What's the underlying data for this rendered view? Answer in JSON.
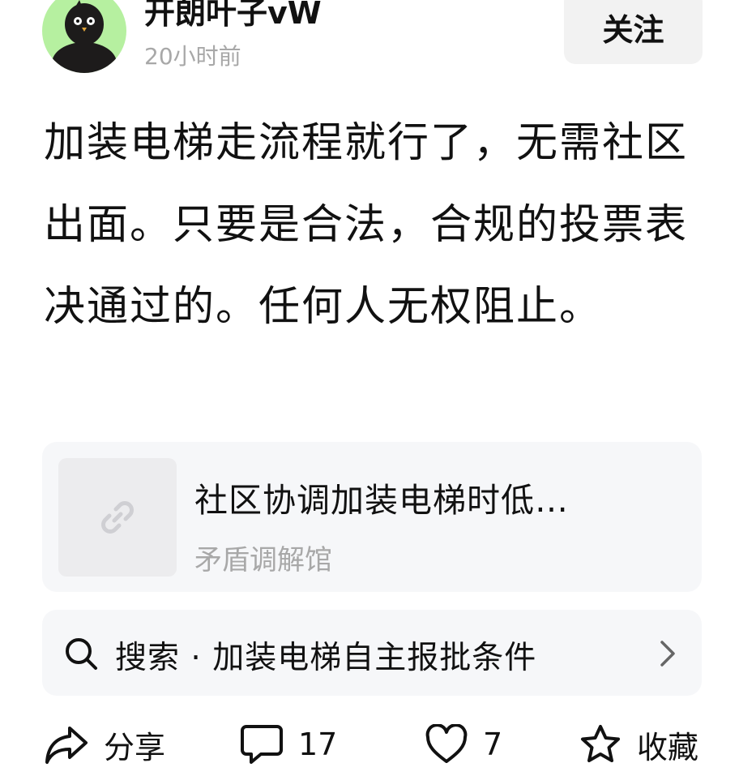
{
  "header": {
    "username": "开朗叶子vW",
    "time": "20小时前",
    "follow_label": "关注"
  },
  "post": {
    "text": "加装电梯走流程就行了，无需社区出面。只要是合法，合规的投票表决通过的。任何人无权阻止。"
  },
  "link_card": {
    "icon": "link-icon",
    "title": "社区协调加装电梯时低…",
    "source": "矛盾调解馆"
  },
  "search": {
    "icon": "search-icon",
    "text": "搜索 · 加装电梯自主报批条件"
  },
  "actions": {
    "share_label": "分享",
    "comment_count": "17",
    "like_count": "7",
    "favorite_label": "收藏"
  }
}
